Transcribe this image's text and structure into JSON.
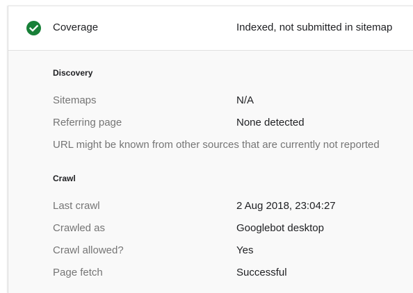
{
  "coverage": {
    "label": "Coverage",
    "status": "Indexed, not submitted in sitemap",
    "status_icon": "check-circle-icon",
    "status_color": "#188038"
  },
  "discovery": {
    "title": "Discovery",
    "sitemaps_label": "Sitemaps",
    "sitemaps_value": "N/A",
    "referring_label": "Referring page",
    "referring_value": "None detected",
    "note": "URL might be known from other sources that are currently not reported"
  },
  "crawl": {
    "title": "Crawl",
    "last_crawl_label": "Last crawl",
    "last_crawl_value": "2 Aug 2018, 23:04:27",
    "crawled_as_label": "Crawled as",
    "crawled_as_value": "Googlebot desktop",
    "crawl_allowed_label": "Crawl allowed?",
    "crawl_allowed_value": "Yes",
    "page_fetch_label": "Page fetch",
    "page_fetch_value": "Successful"
  }
}
